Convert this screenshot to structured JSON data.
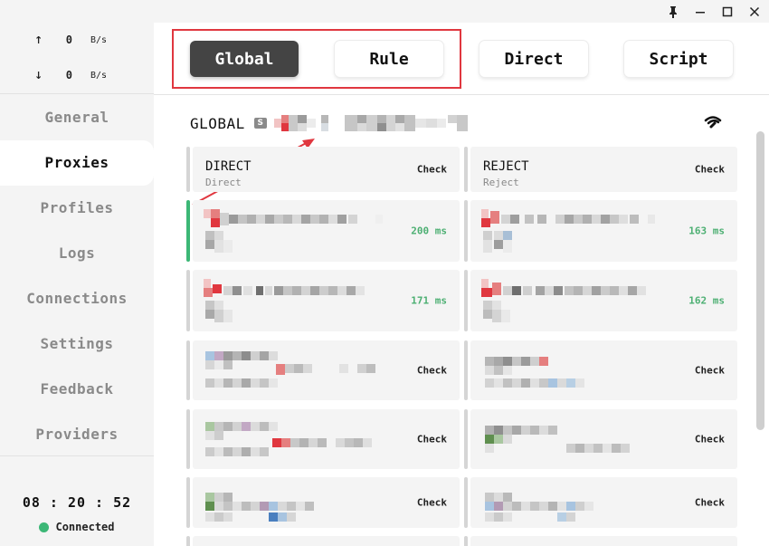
{
  "window": {
    "pin_icon": "pin-icon",
    "minimize_icon": "minimize-icon",
    "maximize_icon": "maximize-icon",
    "close_icon": "close-icon"
  },
  "traffic": {
    "up_arrow": "↑",
    "down_arrow": "↓",
    "up_value": "0",
    "up_unit": "B/s",
    "down_value": "0",
    "down_unit": "B/s"
  },
  "nav": {
    "items": [
      {
        "label": "General",
        "active": false
      },
      {
        "label": "Proxies",
        "active": true
      },
      {
        "label": "Profiles",
        "active": false
      },
      {
        "label": "Logs",
        "active": false
      },
      {
        "label": "Connections",
        "active": false
      },
      {
        "label": "Settings",
        "active": false
      },
      {
        "label": "Feedback",
        "active": false
      },
      {
        "label": "Providers",
        "active": false
      }
    ]
  },
  "clock": "08 : 20 : 52",
  "status": {
    "label": "Connected",
    "color": "#3cb776"
  },
  "modes": [
    {
      "label": "Global",
      "active": true
    },
    {
      "label": "Rule",
      "active": false
    },
    {
      "label": "Direct",
      "active": false
    },
    {
      "label": "Script",
      "active": false
    }
  ],
  "group": {
    "title": "GLOBAL",
    "badge": "S",
    "icon": "wifi-icon"
  },
  "proxies": [
    {
      "name": "DIRECT",
      "type": "Direct",
      "action": "Check",
      "delay": "",
      "active": false
    },
    {
      "name": "REJECT",
      "type": "Reject",
      "action": "Check",
      "delay": "",
      "active": false
    },
    {
      "name": "",
      "type": "",
      "action": "",
      "delay": "200 ms",
      "active": true
    },
    {
      "name": "",
      "type": "",
      "action": "",
      "delay": "163 ms",
      "active": false
    },
    {
      "name": "",
      "type": "",
      "action": "",
      "delay": "171 ms",
      "active": false
    },
    {
      "name": "",
      "type": "",
      "action": "",
      "delay": "162 ms",
      "active": false
    },
    {
      "name": "",
      "type": "",
      "action": "Check",
      "delay": "",
      "active": false
    },
    {
      "name": "",
      "type": "",
      "action": "Check",
      "delay": "",
      "active": false
    },
    {
      "name": "",
      "type": "",
      "action": "Check",
      "delay": "",
      "active": false
    },
    {
      "name": "",
      "type": "",
      "action": "Check",
      "delay": "",
      "active": false
    },
    {
      "name": "",
      "type": "",
      "action": "Check",
      "delay": "",
      "active": false
    },
    {
      "name": "",
      "type": "",
      "action": "Check",
      "delay": "",
      "active": false
    }
  ],
  "colors": {
    "accent": "#444444",
    "highlight": "#e0373f",
    "connected": "#3cb776",
    "delay": "#4caf72"
  }
}
